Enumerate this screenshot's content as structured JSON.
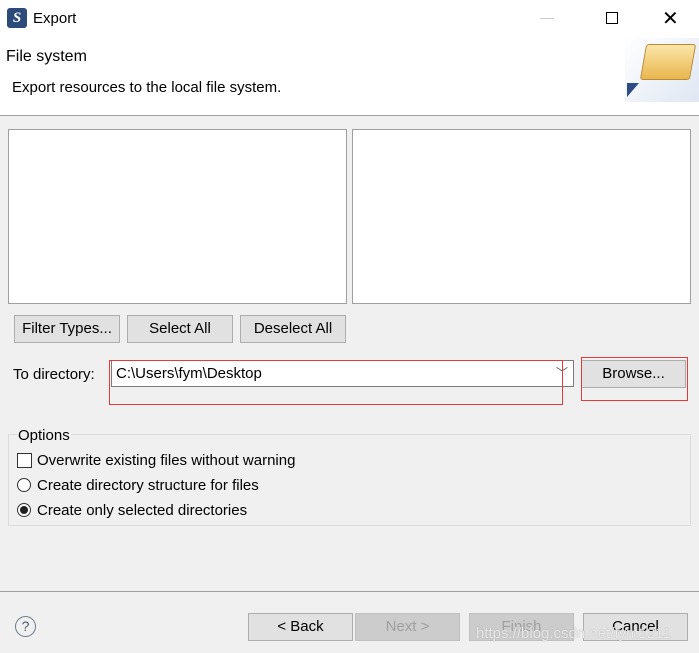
{
  "window": {
    "title": "Export",
    "app_icon": "eclipse-icon"
  },
  "header": {
    "title": "File system",
    "description": "Export resources to the local file system.",
    "banner_icon": "folder-icon"
  },
  "buttons": {
    "filter_types": "Filter Types...",
    "select_all": "Select All",
    "deselect_all": "Deselect All",
    "browse": "Browse...",
    "back": "< Back",
    "next": "Next >",
    "finish": "Finish",
    "cancel": "Cancel"
  },
  "directory": {
    "label": "To directory:",
    "value": "C:\\Users\\fym\\Desktop"
  },
  "options": {
    "legend": "Options",
    "overwrite": {
      "label": "Overwrite existing files without warning",
      "checked": false
    },
    "create_structure": {
      "label": "Create directory structure for files",
      "selected": false
    },
    "create_selected": {
      "label": "Create only selected directories",
      "selected": true
    }
  },
  "watermark": "https://blog.csdn.net/fym1211"
}
